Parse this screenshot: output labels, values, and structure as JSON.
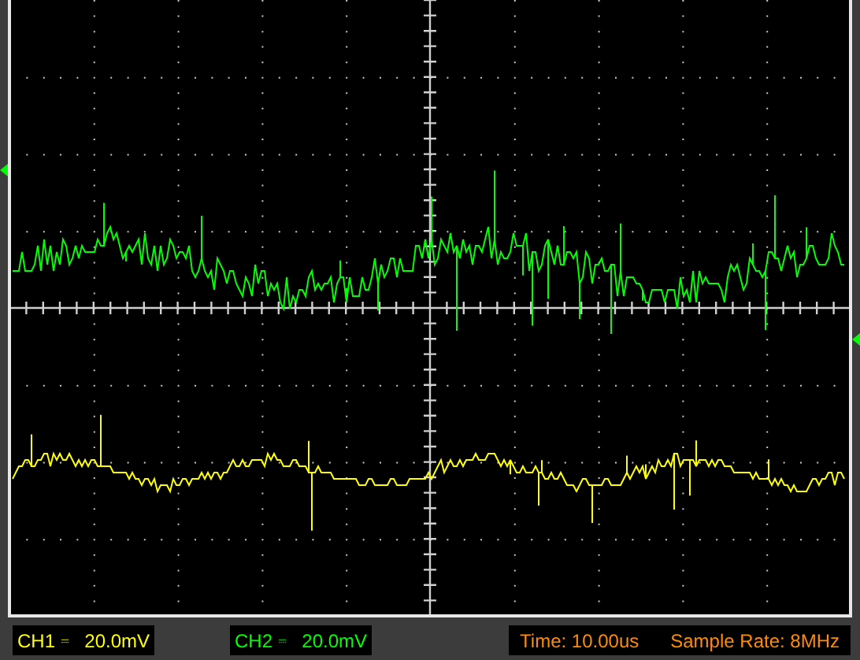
{
  "scope": {
    "traces": [
      {
        "color": "#00ff00",
        "ground_marker": true
      },
      {
        "color": "#ffff00",
        "ground_marker": false
      }
    ],
    "trigger_marker": {
      "color": "#00ff00"
    }
  },
  "status_bar": {
    "channels": [
      {
        "label": "CH1",
        "scale": "20.0mV",
        "color": "#ffff00"
      },
      {
        "label": "CH2",
        "scale": "20.0mV",
        "color": "#00ff00"
      }
    ],
    "time": "Time: 10.00us",
    "sample_rate": "Sample Rate: 8MHz"
  }
}
